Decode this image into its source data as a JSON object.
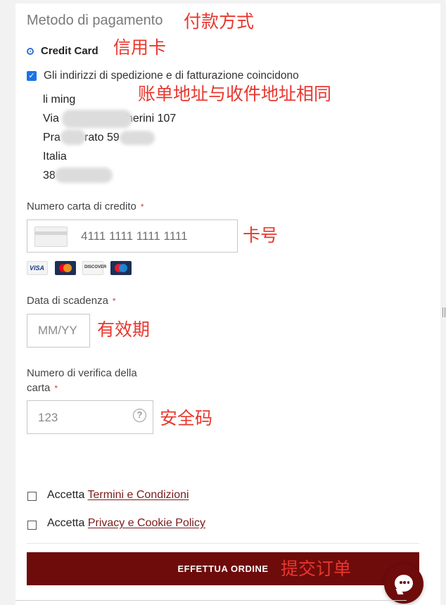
{
  "payment": {
    "title": "Metodo di pagamento",
    "method_label": "Credit Card",
    "same_address_label": "Gli indirizzi di spedizione e di fatturazione coincidono",
    "address_lines": [
      "li ming",
      "Via ",
      "cherini 107",
      "Pra",
      "rato 59",
      "Italia",
      "38"
    ]
  },
  "card_number": {
    "label": "Numero carta di credito",
    "required": "*",
    "value": "4111 1111 1111 1111",
    "brands": [
      "VISA",
      "mastercard",
      "DISCOVER",
      "maestro"
    ]
  },
  "expiry": {
    "label": "Data di scadenza",
    "required": "*",
    "placeholder": "MM/YY"
  },
  "cvv": {
    "label_line1": "Numero di verifica della",
    "label_line2": "carta",
    "required": "*",
    "placeholder": "123",
    "help": "?"
  },
  "terms": {
    "accept": "Accetta",
    "terms_link": "Termini e Condizioni",
    "privacy_link": "Privacy e Cookie Policy"
  },
  "submit": {
    "label": "EFFETTUA ORDINE"
  },
  "annotations": {
    "payment_method": "付款方式",
    "credit_card": "信用卡",
    "same_address": "账单地址与收件地址相同",
    "card_number": "卡号",
    "expiry": "有效期",
    "cvv": "安全码",
    "submit": "提交订单"
  },
  "colors": {
    "accent": "#6e0b0b",
    "annotation": "#e8372e",
    "checkbox": "#1a73e8"
  }
}
